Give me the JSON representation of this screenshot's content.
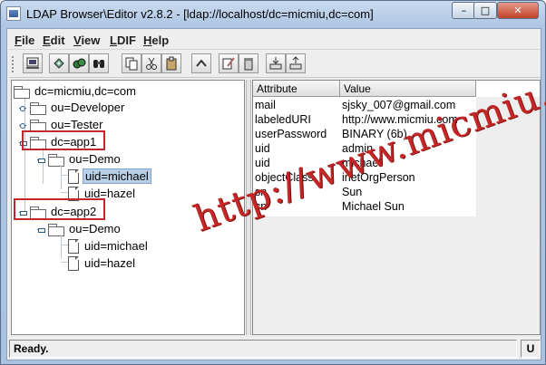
{
  "window": {
    "title": "LDAP Browser\\Editor v2.8.2 - [ldap://localhost/dc=micmiu,dc=com]",
    "min_glyph": "–",
    "max_glyph": "□",
    "close_glyph": "✕"
  },
  "menu": [
    {
      "key": "F",
      "rest": "ile"
    },
    {
      "key": "E",
      "rest": "dit"
    },
    {
      "key": "V",
      "rest": "iew"
    },
    {
      "key": "L",
      "rest": "DIF"
    },
    {
      "key": "H",
      "rest": "elp"
    }
  ],
  "toolbar": {
    "icons": [
      "connect-icon",
      "refresh-icon",
      "search-binoculars-icon",
      "search-binoculars2-icon",
      "copy-icon",
      "cut-icon",
      "paste-icon",
      "up-icon",
      "edit-icon",
      "delete-icon",
      "export-icon",
      "import-icon"
    ]
  },
  "tree": {
    "root": "dc=micmiu,dc=com",
    "nodes": [
      "ou=Developer",
      "ou=Tester",
      "dc=app1",
      "ou=Demo",
      "uid=michael",
      "uid=hazel",
      "dc=app2",
      "ou=Demo",
      "uid=michael",
      "uid=hazel"
    ]
  },
  "table": {
    "headers": [
      "Attribute",
      "Value"
    ],
    "rows": [
      [
        "mail",
        "sjsky_007@gmail.com"
      ],
      [
        "labeledURI",
        "http://www.micmiu.com"
      ],
      [
        "userPassword",
        "BINARY (6b)"
      ],
      [
        "uid",
        "admin"
      ],
      [
        "uid",
        "michael"
      ],
      [
        "objectClass",
        "inetOrgPerson"
      ],
      [
        "sn",
        "Sun"
      ],
      [
        "cn",
        "Michael Sun"
      ]
    ]
  },
  "watermark": "http://www.micmiu.com",
  "status": {
    "text": "Ready.",
    "indicator": "U"
  },
  "colors": {
    "highlight_box": "#c1272d",
    "selection": "#b8cfe5",
    "watermark": "#c52727"
  }
}
